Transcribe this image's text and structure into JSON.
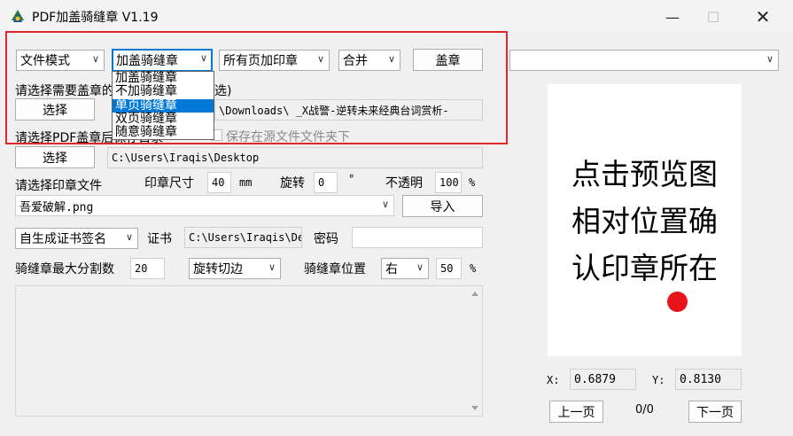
{
  "window": {
    "title": "PDF加盖骑缝章 V1.19",
    "min_icon": "minimize-icon",
    "max_icon": "maximize-icon",
    "close_icon": "close-icon",
    "min_glyph": "—",
    "max_glyph": "☐",
    "close_glyph": "✕"
  },
  "row1": {
    "mode": "文件模式",
    "stamp_type": "加盖骑缝章",
    "pages": "所有页加印章",
    "merge": "合并",
    "stamp_button": "盖章",
    "right_combo": ""
  },
  "dropdown": {
    "items": [
      "加盖骑缝章",
      "不加骑缝章",
      "单页骑缝章",
      "双页骑缝章",
      "随意骑缝章"
    ],
    "selected_index": 2
  },
  "pdf": {
    "label_prefix": "请选择需要盖章的",
    "label_suffix": "选)",
    "select_button": "选择",
    "path": "\\Downloads\\  _X战警-逆转未来经典台词赏析-"
  },
  "output": {
    "label": "请选择PDF盖章后保存目录",
    "save_in_source": "保存在源文件文件夹下",
    "select_button": "选择",
    "path": "C:\\Users\\Iraqis\\Desktop"
  },
  "seal": {
    "label": "请选择印章文件",
    "size_label": "印章尺寸",
    "size_value": "40",
    "size_unit": "mm",
    "rotate_label": "旋转",
    "rotate_value": "0",
    "rotate_unit": "°",
    "opacity_label": "不透明",
    "opacity_value": "100",
    "opacity_unit": "%",
    "file": "吾爱破解.png",
    "import_button": "导入"
  },
  "cert": {
    "sign_mode": "自生成证书签名",
    "cert_label": "证书",
    "cert_path": "C:\\Users\\Iraqis\\De",
    "password_label": "密码",
    "password": ""
  },
  "qifeng": {
    "max_split_label": "骑缝章最大分割数",
    "max_split_value": "20",
    "cut_mode": "旋转切边",
    "position_label": "骑缝章位置",
    "position": "右",
    "position_value": "50",
    "position_unit": "%"
  },
  "preview": {
    "lines": [
      "点击预览图",
      "相对位置确",
      "认印章所在"
    ],
    "x_label": "X:",
    "x_value": "0.6879",
    "y_label": "Y:",
    "y_value": "0.8130",
    "prev_button": "上一页",
    "page_counter": "0/0",
    "next_button": "下一页"
  },
  "colors": {
    "highlight": "#0078d7",
    "annotation_box": "#e0282b",
    "seal_dot": "#e8141c"
  }
}
